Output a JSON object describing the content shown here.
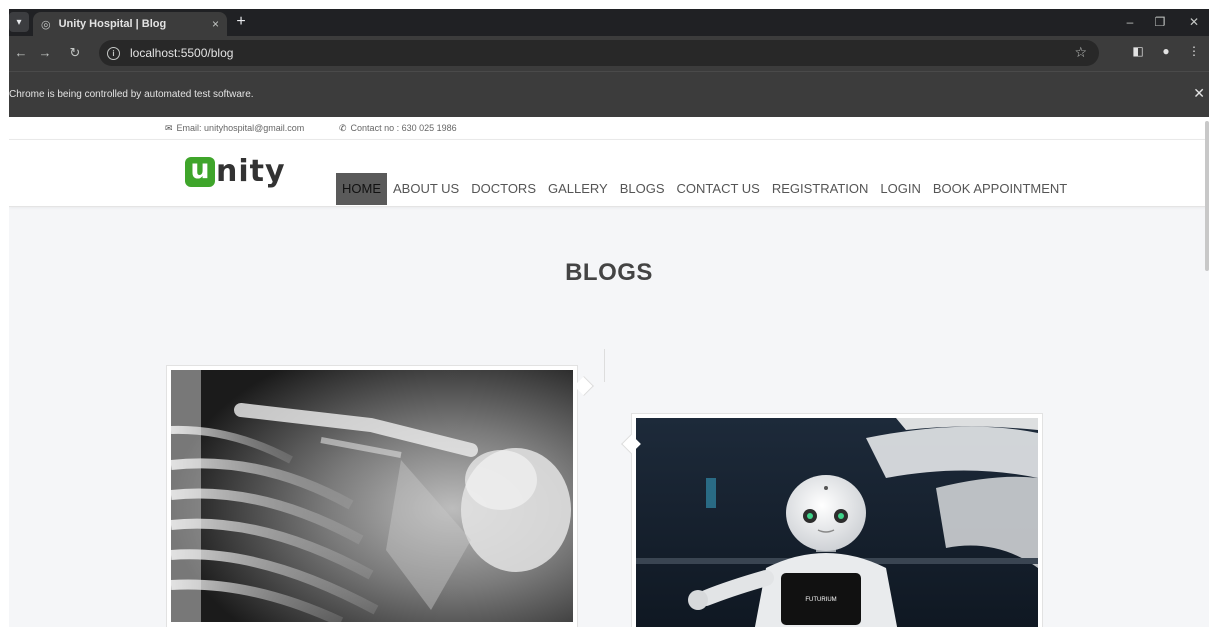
{
  "browser": {
    "tab_title": "Unity Hospital | Blog",
    "url": "localhost:5500/blog",
    "infobar_message": "Chrome is being controlled by automated test software.",
    "new_tab_symbol": "+",
    "close_symbol": "×"
  },
  "topinfo": {
    "email": "Email: unityhospital@gmail.com",
    "contact": "Contact no : 630 025 1986"
  },
  "logo": {
    "first_letter": "u",
    "rest": "nity",
    "accent_color": "#3fa52b"
  },
  "nav": {
    "items": [
      "HOME",
      "ABOUT US",
      "DOCTORS",
      "GALLERY",
      "BLOGS",
      "CONTACT US",
      "REGISTRATION",
      "LOGIN",
      "BOOK APPOINTMENT"
    ],
    "active_index": 0
  },
  "page": {
    "heading": "BLOGS"
  },
  "cards": [
    {
      "image": "chest-xray-image"
    },
    {
      "image": "robot-image",
      "robot_tablet_text": "FUTURIUM"
    }
  ]
}
